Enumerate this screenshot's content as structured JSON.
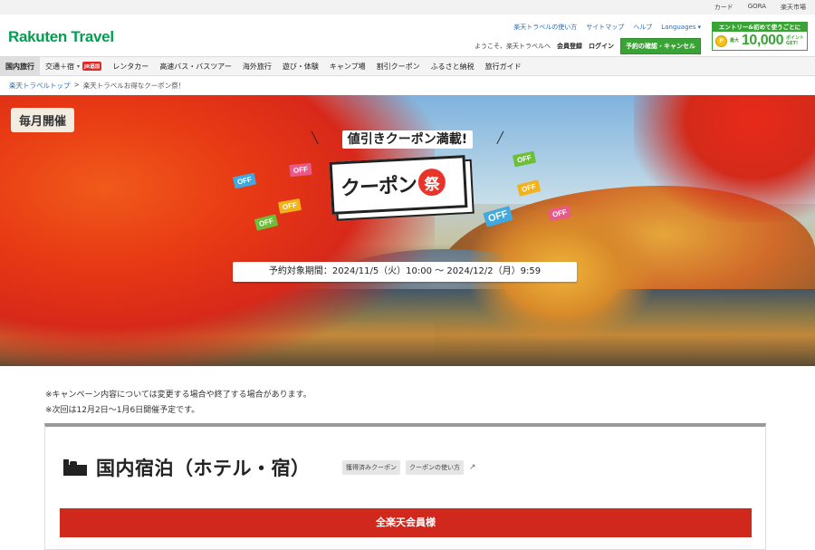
{
  "util_bar": {
    "links": [
      "カード",
      "GORA",
      "楽天市場"
    ]
  },
  "header": {
    "logo": "Rakuten Travel",
    "help_links": [
      "楽天トラベルの使い方",
      "サイトマップ",
      "ヘルプ"
    ],
    "languages": "Languages",
    "welcome": "ようこそ、楽天トラベルへ",
    "member_register": "会員登録",
    "login": "ログイン",
    "reserve_button": "予約の確認・キャンセル",
    "entry": {
      "top": "エントリー&初めて使うごとに",
      "prefix": "最大",
      "amount": "10,000",
      "suffix_1": "ポイント",
      "suffix_2": "GET!",
      "coin": "P"
    }
  },
  "nav": {
    "items": [
      {
        "label": "国内旅行",
        "active": true
      },
      {
        "label": "交通＋宿",
        "badge": "JR追加"
      },
      {
        "label": "レンタカー"
      },
      {
        "label": "高速バス・バスツアー"
      },
      {
        "label": "海外旅行"
      },
      {
        "label": "遊び・体験"
      },
      {
        "label": "キャンプ場"
      },
      {
        "label": "割引クーポン"
      },
      {
        "label": "ふるさと納税"
      },
      {
        "label": "旅行ガイド"
      }
    ]
  },
  "breadcrumb": {
    "home": "楽天トラベルトップ",
    "sep": ">",
    "current": "楽天トラベルお得なクーポン祭！"
  },
  "hero": {
    "monthly_tag": "毎月開催",
    "catch": "値引きクーポン満載!",
    "coupon": "クーポン",
    "matsuri": "祭",
    "off_label": "OFF",
    "period": "予約対象期間：2024/11/5（火）10:00 〜 2024/12/2（月）9:59"
  },
  "notes": [
    "※キャンペーン内容については変更する場合や終了する場合があります。",
    "※次回は12月2日〜1月6日開催予定です。"
  ],
  "section": {
    "title": "国内宿泊（ホテル・宿）",
    "chip_obtained": "獲得済みクーポン",
    "chip_howto": "クーポンの使い方",
    "member_bar": "全楽天会員様"
  },
  "colors": {
    "brand_green": "#00a050",
    "accent_red": "#d0281d"
  }
}
